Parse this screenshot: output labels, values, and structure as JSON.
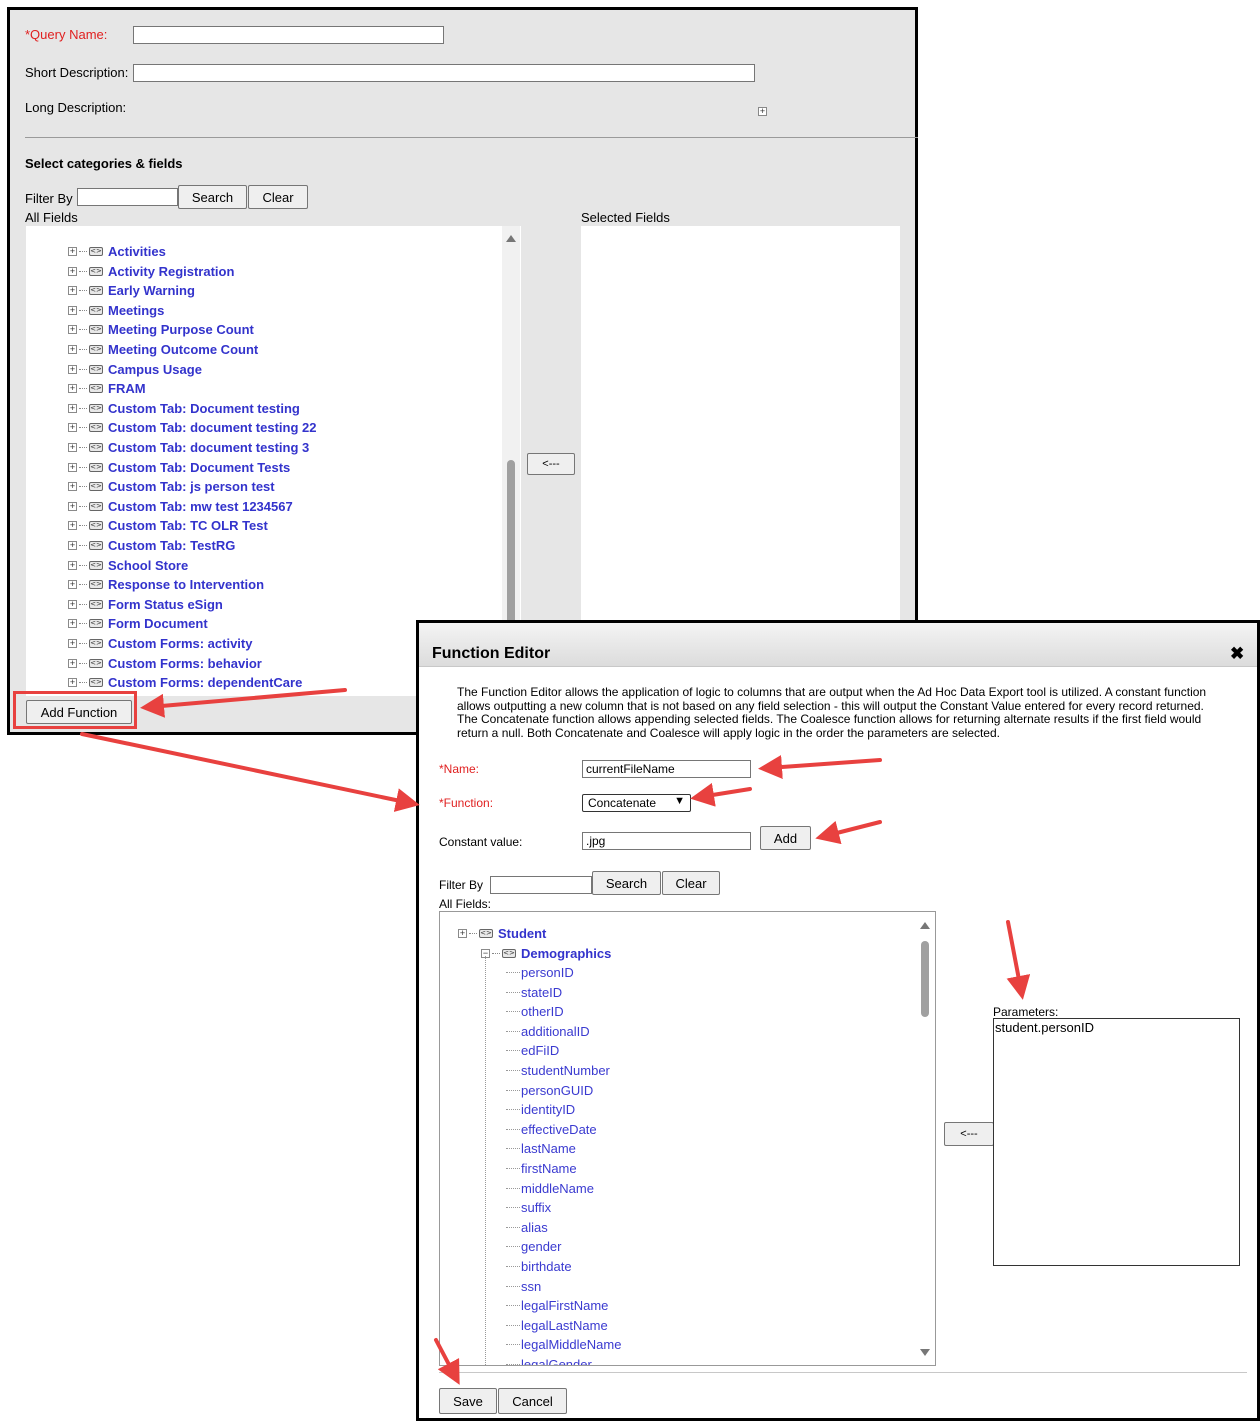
{
  "query_form": {
    "query_name_label": "*Query Name:",
    "query_name_value": "",
    "short_description_label": "Short Description:",
    "short_description_value": "",
    "long_description_label": "Long Description:",
    "expand_icon": "plus-box-icon",
    "section_title": "Select categories & fields",
    "filter_label": "Filter By",
    "filter_value": "",
    "search_button": "Search",
    "clear_button": "Clear",
    "all_fields_label": "All Fields",
    "selected_fields_label": "Selected Fields",
    "move_left_button": "<---",
    "add_function_button": "Add Function",
    "tree_items": [
      "Activities",
      "Activity Registration",
      "Early Warning",
      "Meetings",
      "Meeting Purpose Count",
      "Meeting Outcome Count",
      "Campus Usage",
      "FRAM",
      "Custom Tab: Document testing",
      "Custom Tab: document testing 22",
      "Custom Tab: document testing 3",
      "Custom Tab: Document Tests",
      "Custom Tab: js person test",
      "Custom Tab: mw test 1234567",
      "Custom Tab: TC OLR Test",
      "Custom Tab: TestRG",
      "School Store",
      "Response to Intervention",
      "Form Status eSign",
      "Form Document",
      "Custom Forms: activity",
      "Custom Forms: behavior",
      "Custom Forms: dependentCare"
    ]
  },
  "function_editor": {
    "title": "Function Editor",
    "close_icon": "close-icon",
    "description": "The Function Editor allows the application of logic to columns that are output when the Ad Hoc Data Export tool is utilized. A constant function allows outputting a new column that is not based on any field selection - this will output the Constant Value entered for every record returned. The Concatenate function allows appending selected fields. The Coalesce function allows for returning alternate results if the first field would return a null. Both Concatenate and Coalesce will apply logic in the order the parameters are selected.",
    "name_label": "*Name:",
    "name_value": "currentFileName",
    "function_label": "*Function:",
    "function_value": "Concatenate",
    "constant_label": "Constant value:",
    "constant_value": ".jpg",
    "add_button": "Add",
    "filter_label": "Filter By",
    "filter_value": "",
    "search_button": "Search",
    "clear_button": "Clear",
    "all_fields_label": "All Fields:",
    "tree_root": "Student",
    "tree_group": "Demographics",
    "tree_leaves": [
      "personID",
      "stateID",
      "otherID",
      "additionalID",
      "edFiID",
      "studentNumber",
      "personGUID",
      "identityID",
      "effectiveDate",
      "lastName",
      "firstName",
      "middleName",
      "suffix",
      "alias",
      "gender",
      "birthdate",
      "ssn",
      "legalFirstName",
      "legalLastName",
      "legalMiddleName",
      "legalGender"
    ],
    "move_left_button": "<---",
    "parameters_label": "Parameters:",
    "parameters": [
      "student.personID"
    ],
    "save_button": "Save",
    "cancel_button": "Cancel"
  },
  "colors": {
    "accent_red": "#e8413f",
    "link_blue": "#3333cc",
    "required_red": "#e02020"
  }
}
